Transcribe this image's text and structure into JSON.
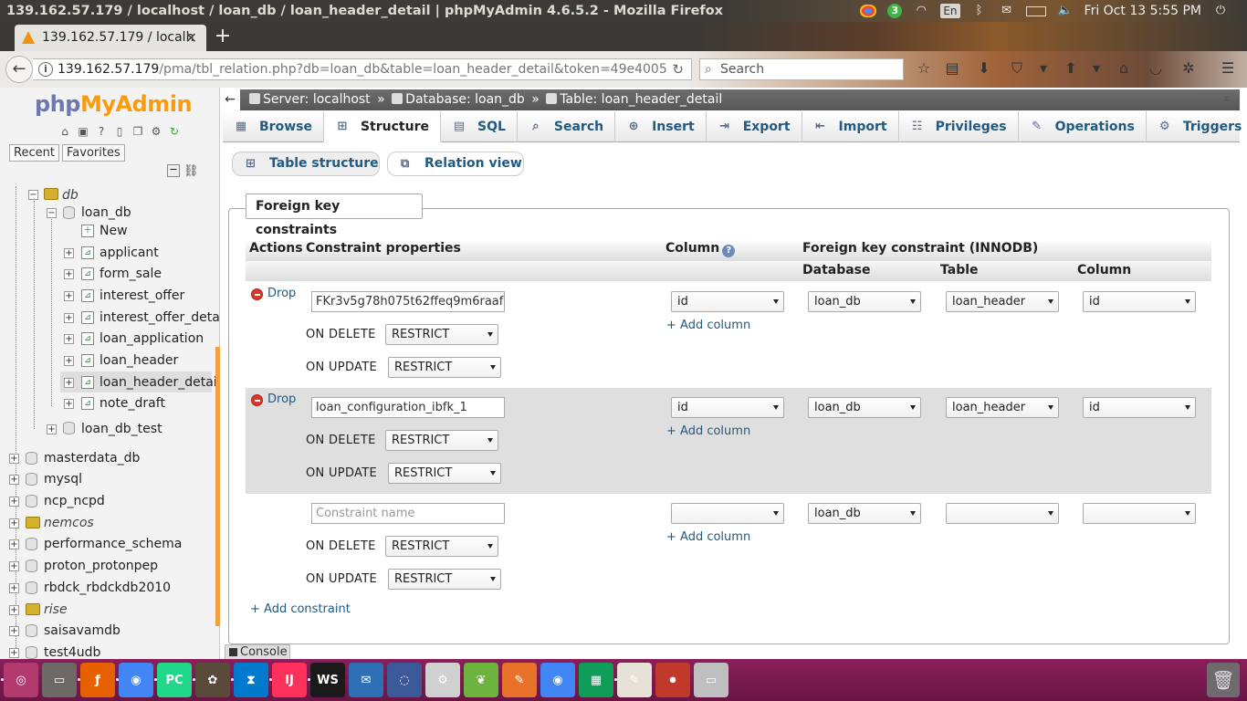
{
  "window": {
    "title": "139.162.57.179 / localhost / loan_db / loan_header_detail | phpMyAdmin 4.6.5.2 - Mozilla Firefox"
  },
  "tray": {
    "badge": "3",
    "lang": "En",
    "clock": "Fri Oct 13  5:55 PM"
  },
  "browser": {
    "tab_title": "139.162.57.179 / localh",
    "url_host": "139.162.57.179",
    "url_path": "/pma/tbl_relation.php?db=loan_db&table=loan_header_detail&token=49e4005",
    "search_placeholder": "Search"
  },
  "sidebar": {
    "logo_a": "php",
    "logo_b": "MyAdmin",
    "recent": "Recent",
    "favorites": "Favorites",
    "tree": {
      "db": "db",
      "loan_db": "loan_db",
      "new": "New",
      "tables": [
        "applicant",
        "form_sale",
        "interest_offer",
        "interest_offer_deta",
        "loan_application",
        "loan_header",
        "loan_header_detai",
        "note_draft"
      ],
      "loan_db_test": "loan_db_test",
      "databases": [
        "masterdata_db",
        "mysql",
        "ncp_ncpd",
        "nemcos",
        "performance_schema",
        "proton_protonpep",
        "rbdck_rbdckdb2010",
        "rise",
        "saisavamdb",
        "test4udb"
      ]
    }
  },
  "breadcrumb": {
    "server": "Server: localhost",
    "database": "Database: loan_db",
    "table": "Table: loan_header_detail",
    "sep": "»"
  },
  "tabs": [
    "Browse",
    "Structure",
    "SQL",
    "Search",
    "Insert",
    "Export",
    "Import",
    "Privileges",
    "Operations",
    "Triggers"
  ],
  "subtabs": {
    "table_structure": "Table structure",
    "relation_view": "Relation view"
  },
  "fk": {
    "legend": "Foreign key constraints",
    "headers": {
      "actions": "Actions",
      "props": "Constraint properties",
      "column": "Column",
      "fk": "Foreign key constraint (INNODB)",
      "database": "Database",
      "table": "Table",
      "column2": "Column"
    },
    "drop": "Drop",
    "on_delete": "ON DELETE",
    "on_update": "ON UPDATE",
    "add_column": "+ Add column",
    "add_constraint": "+ Add constraint",
    "name_placeholder": "Constraint name",
    "rows": [
      {
        "name": "FKr3v5g78h075t62ffeq9m6raaf",
        "on_delete": "RESTRICT",
        "on_update": "RESTRICT",
        "column": "id",
        "ref_db": "loan_db",
        "ref_table": "loan_header",
        "ref_column": "id"
      },
      {
        "name": "loan_configuration_ibfk_1",
        "on_delete": "RESTRICT",
        "on_update": "RESTRICT",
        "column": "id",
        "ref_db": "loan_db",
        "ref_table": "loan_header",
        "ref_column": "id"
      },
      {
        "name": "",
        "on_delete": "RESTRICT",
        "on_update": "RESTRICT",
        "column": "",
        "ref_db": "loan_db",
        "ref_table": "",
        "ref_column": ""
      }
    ]
  },
  "console": "Console",
  "dock": [
    "Ubuntu",
    "Files",
    "Firefox",
    "Chrome",
    "PyCharm",
    "Calc",
    "VS Code",
    "IntelliJ",
    "WebStorm",
    "Thunderbird",
    "Pidgin",
    "Settings",
    "Spring",
    "Pencil",
    "Chrome",
    "Sheets",
    "Editor",
    "Recorder",
    "Drive"
  ],
  "colors": {
    "link": "#235a81",
    "dock": "#7a1a4f",
    "splitter": "#f5a040"
  }
}
